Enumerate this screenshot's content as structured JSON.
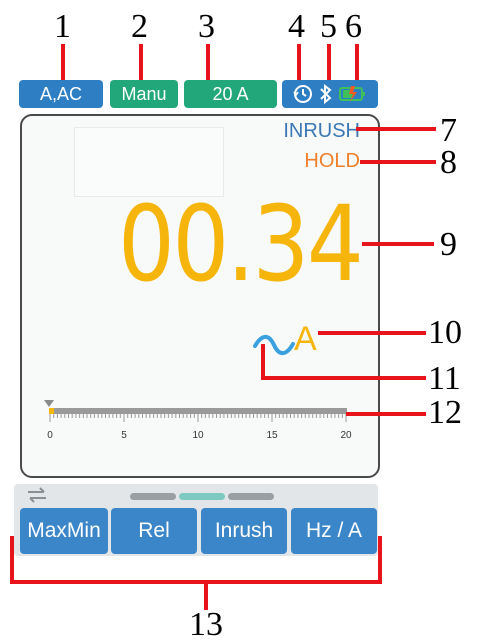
{
  "status_bar": {
    "function_label": "A,AC",
    "range_mode_label": "Manu",
    "range_value_label": "20 A",
    "icons": [
      "clock-icon",
      "bluetooth-icon",
      "battery-icon"
    ]
  },
  "display": {
    "mode_indicator": "INRUSH",
    "hold_indicator": "HOLD",
    "reading": "00.34",
    "unit": "A",
    "ac_symbol": "~"
  },
  "bar_graph": {
    "ticks": [
      "0",
      "5",
      "10",
      "15",
      "20"
    ],
    "value": 0.34,
    "max": 20
  },
  "toolbar": {
    "swap_icon": "swap-arrows-icon",
    "page_indicator": {
      "pages": 3,
      "active": 2
    },
    "buttons": [
      "MaxMin",
      "Rel",
      "Inrush",
      "Hz / A"
    ]
  },
  "callouts": [
    "1",
    "2",
    "3",
    "4",
    "5",
    "6",
    "7",
    "8",
    "9",
    "10",
    "11",
    "12",
    "13"
  ],
  "colors": {
    "pill_blue": "#2e7ec4",
    "pill_green": "#22a77a",
    "reading_amber": "#f5b50b",
    "hold_orange": "#f07f2c",
    "inrush_blue": "#3a78b5",
    "ac_symbol_blue": "#3aa0e0",
    "callout_red": "#e8141b"
  }
}
